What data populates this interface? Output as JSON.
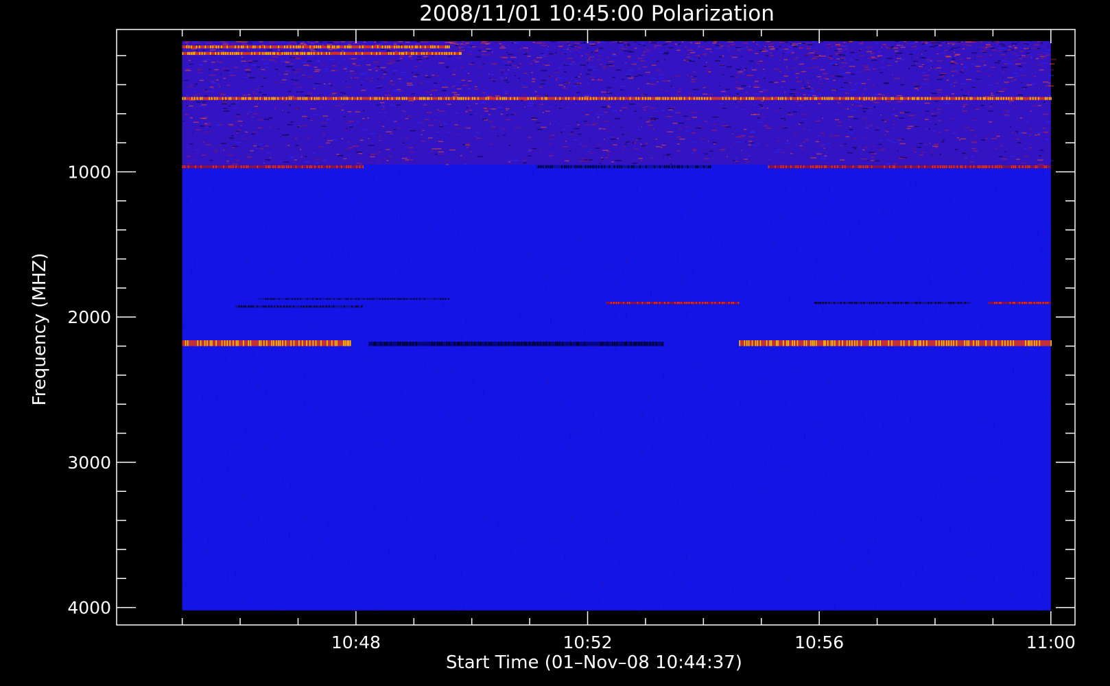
{
  "chart_data": {
    "type": "heatmap",
    "title": "2008/11/01  10:45:00 Polarization",
    "xlabel": "Start Time (01–Nov–08 10:44:37)",
    "ylabel": "Frequency (MHZ)",
    "x_ticks": [
      {
        "value": 3.383,
        "label": "10:48"
      },
      {
        "value": 7.383,
        "label": "10:52"
      },
      {
        "value": 11.383,
        "label": "10:56"
      },
      {
        "value": 15.383,
        "label": "11:00"
      }
    ],
    "y_ticks": [
      {
        "value": 1000,
        "label": "1000"
      },
      {
        "value": 2000,
        "label": "2000"
      },
      {
        "value": 3000,
        "label": "3000"
      },
      {
        "value": 4000,
        "label": "4000"
      }
    ],
    "xlim": [
      -0.75,
      15.8
    ],
    "ylim": [
      4120,
      20
    ],
    "data_x_range": [
      0.383,
      15.383
    ],
    "data_y_range": [
      100,
      4020
    ],
    "colors": {
      "background_field": "#1414e6",
      "strong_positive": "#ffe000",
      "positive": "#ff3a00",
      "negative": "#000014",
      "noise": "#8a1466"
    },
    "bands": [
      {
        "y_from": 100,
        "y_to": 950,
        "kind": "noisy",
        "note": "high-noise region"
      },
      {
        "y_from": 130,
        "y_to": 150,
        "kind": "positive",
        "x_from": 0.383,
        "x_to": 5.0,
        "intensity": "strong"
      },
      {
        "y_from": 175,
        "y_to": 195,
        "kind": "positive",
        "x_from": 0.383,
        "x_to": 5.2,
        "intensity": "strong"
      },
      {
        "y_from": 485,
        "y_to": 505,
        "kind": "positive",
        "x_from": 0.383,
        "x_to": 15.383,
        "intensity": "strong"
      },
      {
        "y_from": 955,
        "y_to": 975,
        "kind": "positive",
        "x_from": 0.383,
        "x_to": 3.5,
        "intensity": "medium"
      },
      {
        "y_from": 955,
        "y_to": 975,
        "kind": "negative",
        "x_from": 6.5,
        "x_to": 9.5,
        "intensity": "medium"
      },
      {
        "y_from": 955,
        "y_to": 975,
        "kind": "positive",
        "x_from": 10.5,
        "x_to": 15.383,
        "intensity": "medium"
      },
      {
        "y_from": 1870,
        "y_to": 1880,
        "kind": "negative",
        "x_from": 1.7,
        "x_to": 5.0,
        "intensity": "medium"
      },
      {
        "y_from": 1920,
        "y_to": 1935,
        "kind": "negative",
        "x_from": 1.3,
        "x_to": 3.5,
        "intensity": "medium"
      },
      {
        "y_from": 1895,
        "y_to": 1910,
        "kind": "positive",
        "x_from": 7.7,
        "x_to": 10.0,
        "intensity": "medium"
      },
      {
        "y_from": 1895,
        "y_to": 1910,
        "kind": "negative",
        "x_from": 11.3,
        "x_to": 14.0,
        "intensity": "medium"
      },
      {
        "y_from": 1895,
        "y_to": 1910,
        "kind": "positive",
        "x_from": 14.3,
        "x_to": 15.383,
        "intensity": "medium"
      },
      {
        "y_from": 2160,
        "y_to": 2200,
        "kind": "positive",
        "x_from": 0.383,
        "x_to": 3.3,
        "intensity": "strong"
      },
      {
        "y_from": 2170,
        "y_to": 2200,
        "kind": "negative",
        "x_from": 3.6,
        "x_to": 8.7,
        "intensity": "strong"
      },
      {
        "y_from": 2160,
        "y_to": 2200,
        "kind": "positive",
        "x_from": 10.0,
        "x_to": 15.383,
        "intensity": "strong"
      }
    ]
  }
}
